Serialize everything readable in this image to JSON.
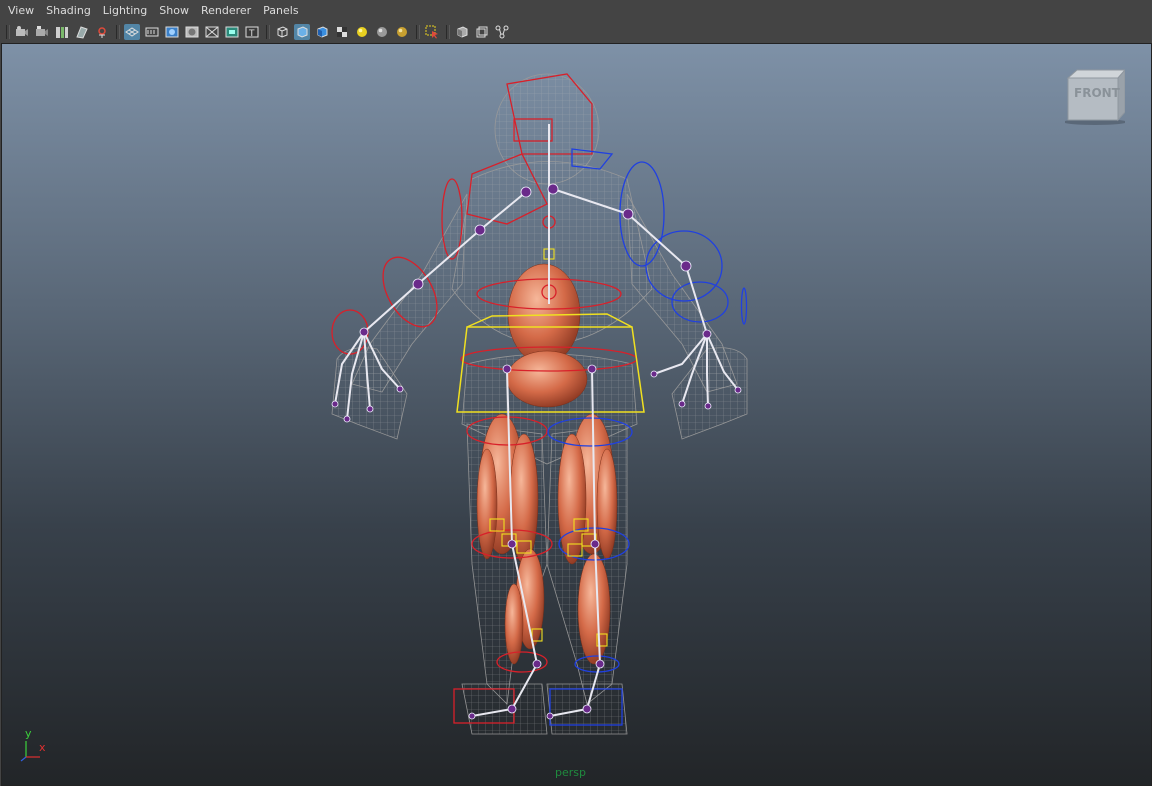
{
  "menubar": {
    "items": [
      {
        "label": "View"
      },
      {
        "label": "Shading"
      },
      {
        "label": "Lighting"
      },
      {
        "label": "Show"
      },
      {
        "label": "Renderer"
      },
      {
        "label": "Panels"
      }
    ]
  },
  "toolbar": {
    "icons": [
      "select-camera-icon",
      "camera-attributes-icon",
      "bookmarks-icon",
      "image-plane-icon",
      "2d-pan-zoom-icon",
      "grid-icon",
      "film-gate-icon",
      "resolution-gate-icon",
      "gate-mask-icon",
      "field-chart-icon",
      "safe-action-icon",
      "safe-title-icon",
      "wireframe-icon",
      "smooth-shade-icon",
      "default-lighting-icon",
      "textured-icon",
      "shadows-icon",
      "screen-space-ao-icon",
      "motion-blur-icon",
      "isolate-select-icon",
      "xray-icon",
      "xray-active-components-icon",
      "xray-joints-icon"
    ],
    "accent": "#5285a6"
  },
  "viewport": {
    "camera_label": "persp",
    "view_cube_label": "FRONT",
    "axis_x": "x",
    "axis_y": "y",
    "colors": {
      "gradient_top": "#7e91a7",
      "gradient_bottom": "#222528",
      "muscle": "#d46a48",
      "control_left": "#d8202a",
      "control_right": "#2040e0",
      "hip_box": "#f0e020",
      "joints": "#6a2a8a",
      "wireframe": "#b8b8b8",
      "camera_label": "#1f8a3e"
    }
  }
}
